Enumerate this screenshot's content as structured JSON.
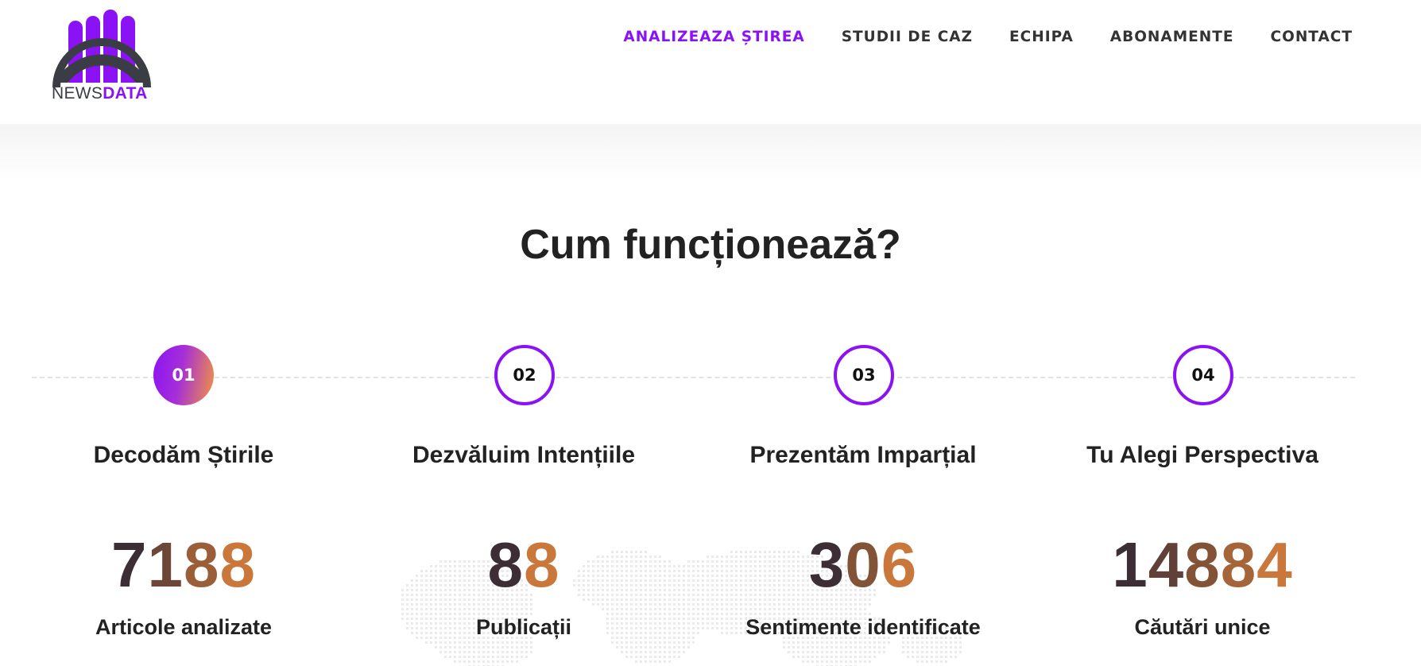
{
  "brand": {
    "logo_text_1": "NEWS",
    "logo_text_2": "DATA"
  },
  "nav": {
    "items": [
      {
        "label": "ANALIZEAZA ȘTIREA",
        "active": true
      },
      {
        "label": "STUDII DE CAZ"
      },
      {
        "label": "ECHIPA"
      },
      {
        "label": "ABONAMENTE"
      },
      {
        "label": "CONTACT"
      }
    ]
  },
  "section": {
    "title": "Cum funcționează?"
  },
  "steps": [
    {
      "number": "01",
      "title": "Decodăm Știrile",
      "stat": "7188",
      "stat_label": "Articole analizate"
    },
    {
      "number": "02",
      "title": "Dezvăluim Intențiile",
      "stat": "88",
      "stat_label": "Publicații"
    },
    {
      "number": "03",
      "title": "Prezentăm Imparțial",
      "stat": "306",
      "stat_label": "Sentimente identificate"
    },
    {
      "number": "04",
      "title": "Tu Alegi Perspectiva",
      "stat": "14884",
      "stat_label": "Căutări unice"
    }
  ],
  "colors": {
    "accent": "#8a12f5",
    "stat_dark": "#3d2e36",
    "stat_light": "#c9773a"
  }
}
